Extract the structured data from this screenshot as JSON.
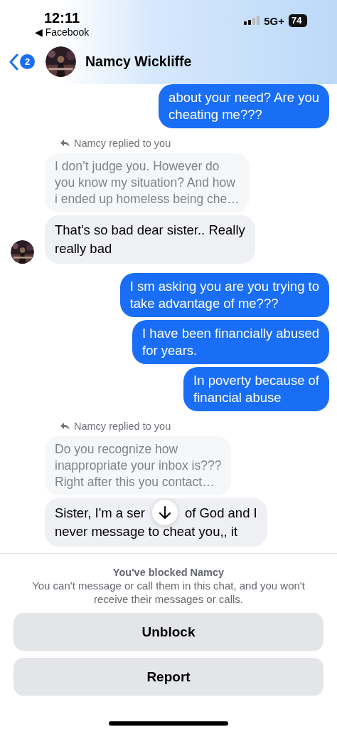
{
  "status_bar": {
    "time": "12:11",
    "back_app": "◀ Facebook",
    "network": "5G+",
    "battery": "74"
  },
  "header": {
    "back_badge": "2",
    "name": "Namcy Wickliffe"
  },
  "messages": [
    {
      "kind": "sent",
      "text": "about your need? Are you\ncheating me???"
    },
    {
      "kind": "reply_note",
      "text": "Namcy replied to you"
    },
    {
      "kind": "quote",
      "text": "I don’t judge you. However do\nyou know my situation? And how\ni ended up homeless being che…"
    },
    {
      "kind": "received",
      "text": "That's so bad dear sister.. Really\nreally bad",
      "avatar": true
    },
    {
      "kind": "sent",
      "text": "I sm asking you are you trying to\ntake advantage of me???"
    },
    {
      "kind": "sent",
      "text": "I have been financially abused\nfor years."
    },
    {
      "kind": "sent",
      "text": "In poverty because of\nfinancial abuse"
    },
    {
      "kind": "reply_note",
      "text": "Namcy replied to you"
    },
    {
      "kind": "quote",
      "text": "Do you recognize how\ninappropriate your inbox is???\nRight after this you contact…"
    },
    {
      "kind": "received",
      "lines": [
        [
          "Sister, I'm a ser",
          "of God and I"
        ],
        [
          "never message to cheat you,, it"
        ]
      ]
    }
  ],
  "blocked": {
    "title": "You've blocked Namcy",
    "description": "You can't message or call them in this chat, and you won't receive their messages or calls.",
    "buttons": [
      "Unblock",
      "Report"
    ]
  }
}
